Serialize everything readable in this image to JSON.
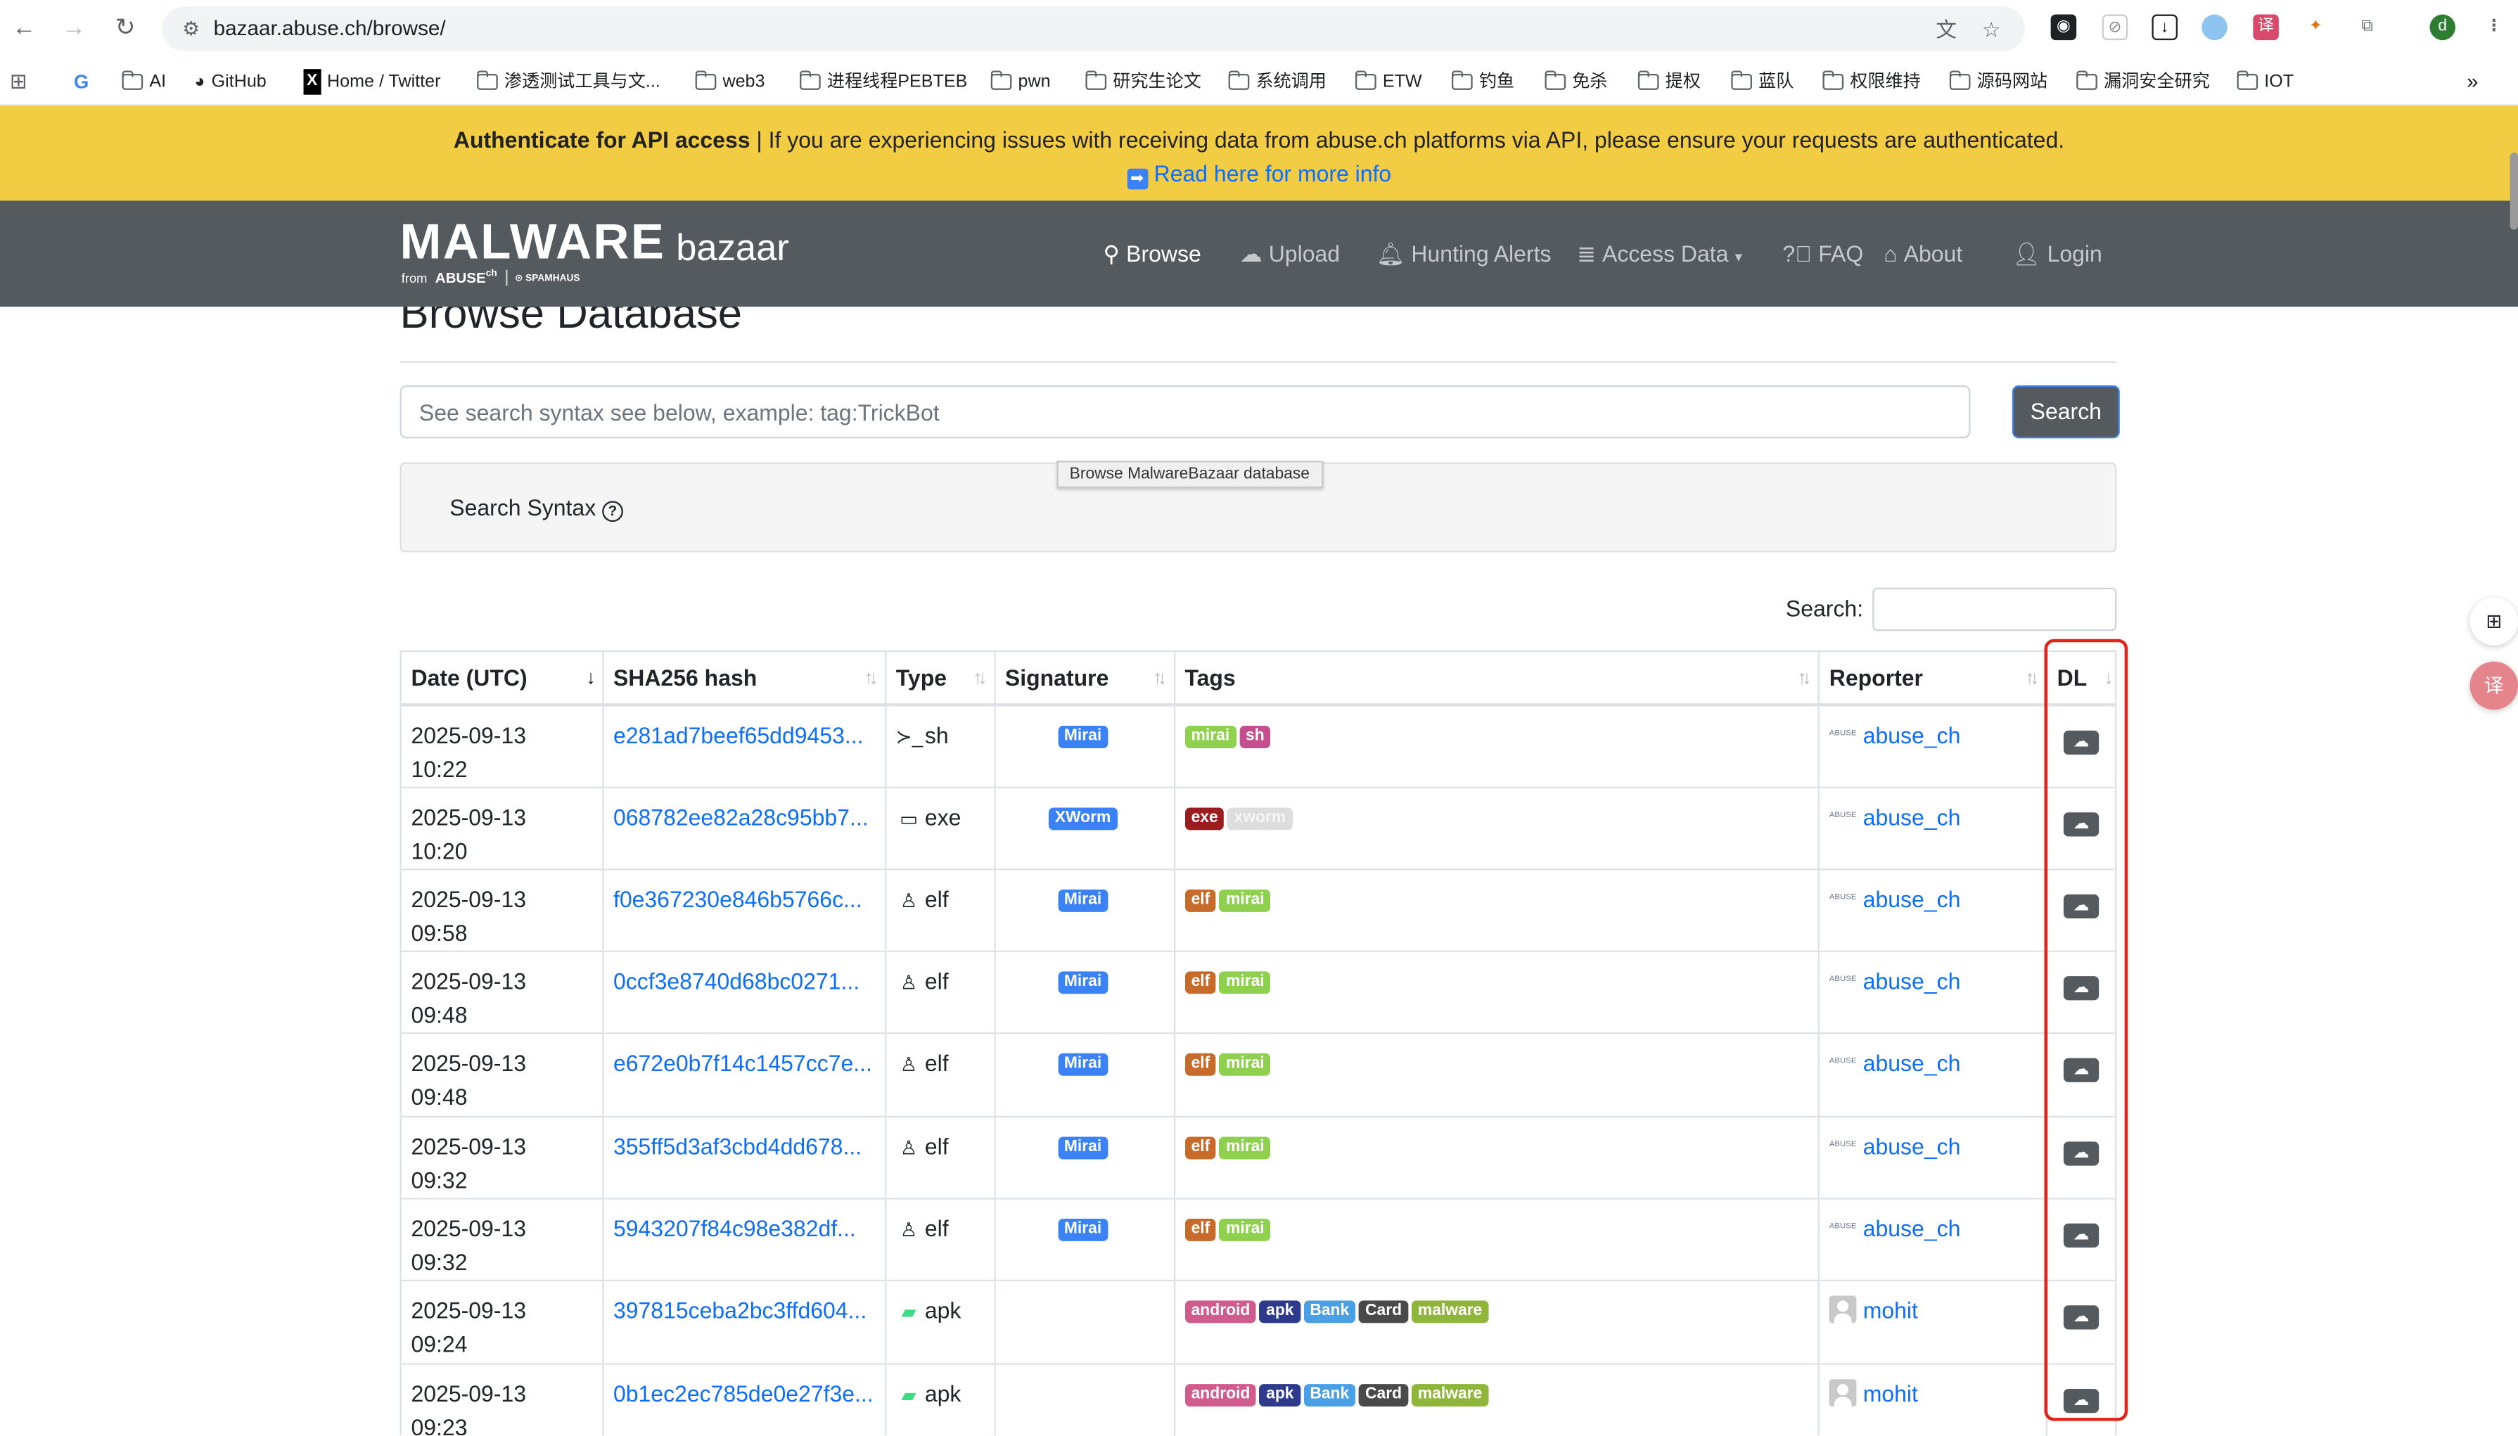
{
  "browser": {
    "url": "bazaar.abuse.ch/browse/",
    "bookmarks": [
      "AI",
      "GitHub",
      "Home / Twitter",
      "渗透测试工具与文...",
      "web3",
      "进程线程PEBTEB",
      "pwn",
      "研究生论文",
      "系统调用",
      "ETW",
      "钓鱼",
      "免杀",
      "提权",
      "蓝队",
      "权限维持",
      "源码网站",
      "漏洞安全研究",
      "IOT"
    ],
    "avatar_letter": "d"
  },
  "banner": {
    "bold": "Authenticate for API access",
    "text": " | If you are experiencing issues with receiving data from abuse.ch platforms via API, please ensure your requests are authenticated.",
    "link": "Read here for more info"
  },
  "navbar": {
    "logo_main": "MALWARE",
    "logo_sub": "bazaar",
    "logo_from": "from",
    "logo_abuse": "ABUSE",
    "logo_abuse_sup": "ch",
    "logo_spamhaus": "SPAMHAUS",
    "items": [
      "Browse",
      "Upload",
      "Hunting Alerts",
      "Access Data",
      "FAQ",
      "About",
      "Login"
    ]
  },
  "page": {
    "title": "Browse Database",
    "search_placeholder": "See search syntax see below, example: tag:TrickBot",
    "search_button": "Search",
    "tooltip": "Browse MalwareBazaar database",
    "syntax_label": "Search Syntax",
    "table_search_label": "Search:"
  },
  "table": {
    "columns": [
      "Date (UTC)",
      "SHA256 hash",
      "Type",
      "Signature",
      "Tags",
      "Reporter",
      "DL"
    ],
    "rows": [
      {
        "date": "2025-09-13",
        "time": "10:22",
        "hash": "e281ad7beef65dd9453...",
        "type": "sh",
        "signature": "Mirai",
        "tags": [
          "mirai",
          "sh"
        ],
        "reporter": "abuse_ch"
      },
      {
        "date": "2025-09-13",
        "time": "10:20",
        "hash": "068782ee82a28c95bb7...",
        "type": "exe",
        "signature": "XWorm",
        "tags": [
          "exe",
          "xworm"
        ],
        "reporter": "abuse_ch"
      },
      {
        "date": "2025-09-13",
        "time": "09:58",
        "hash": "f0e367230e846b5766c...",
        "type": "elf",
        "signature": "Mirai",
        "tags": [
          "elf",
          "mirai"
        ],
        "reporter": "abuse_ch"
      },
      {
        "date": "2025-09-13",
        "time": "09:48",
        "hash": "0ccf3e8740d68bc0271...",
        "type": "elf",
        "signature": "Mirai",
        "tags": [
          "elf",
          "mirai"
        ],
        "reporter": "abuse_ch"
      },
      {
        "date": "2025-09-13",
        "time": "09:48",
        "hash": "e672e0b7f14c1457cc7e...",
        "type": "elf",
        "signature": "Mirai",
        "tags": [
          "elf",
          "mirai"
        ],
        "reporter": "abuse_ch"
      },
      {
        "date": "2025-09-13",
        "time": "09:32",
        "hash": "355ff5d3af3cbd4dd678...",
        "type": "elf",
        "signature": "Mirai",
        "tags": [
          "elf",
          "mirai"
        ],
        "reporter": "abuse_ch"
      },
      {
        "date": "2025-09-13",
        "time": "09:32",
        "hash": "5943207f84c98e382df...",
        "type": "elf",
        "signature": "Mirai",
        "tags": [
          "elf",
          "mirai"
        ],
        "reporter": "abuse_ch"
      },
      {
        "date": "2025-09-13",
        "time": "09:24",
        "hash": "397815ceba2bc3ffd604...",
        "type": "apk",
        "signature": "",
        "tags": [
          "android",
          "apk",
          "Bank",
          "Card",
          "malware"
        ],
        "reporter": "mohit"
      },
      {
        "date": "2025-09-13",
        "time": "09:23",
        "hash": "0b1ec2ec785de0e27f3e...",
        "type": "apk",
        "signature": "",
        "tags": [
          "android",
          "apk",
          "Bank",
          "Card",
          "malware"
        ],
        "reporter": "mohit"
      }
    ]
  },
  "colors": {
    "banner": "#f2cc43",
    "navbar": "#555a5f",
    "link": "#0d6efd",
    "highlight": "#e2231a",
    "badge_sig": "#3b82f6",
    "tag_mirai": "#8fd14f",
    "tag_sh": "#c44e8e",
    "tag_exe": "#9b1c1c",
    "tag_xworm": "#dddddd",
    "tag_elf": "#c76b2b",
    "tag_android": "#cf5c8c",
    "tag_apk": "#2e3a8c",
    "tag_Bank": "#4aa0e6",
    "tag_Card": "#4a4a4a",
    "tag_malware": "#8fb53a"
  }
}
